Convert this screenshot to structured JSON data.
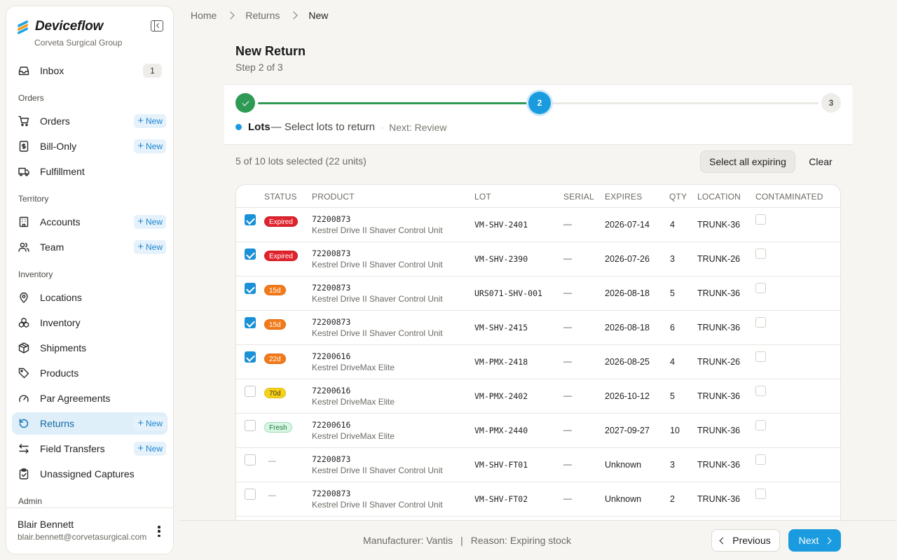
{
  "app": {
    "name": "Deviceflow",
    "org": "Corveta Surgical Group"
  },
  "sidebar": {
    "inbox": {
      "label": "Inbox",
      "count": "1"
    },
    "sections": {
      "orders": "Orders",
      "territory": "Territory",
      "inventory": "Inventory",
      "admin": "Admin"
    },
    "items": {
      "orders": "Orders",
      "bill_only": "Bill-Only",
      "fulfillment": "Fulfillment",
      "accounts": "Accounts",
      "team": "Team",
      "locations": "Locations",
      "inventory": "Inventory",
      "shipments": "Shipments",
      "products": "Products",
      "par_agreements": "Par Agreements",
      "returns": "Returns",
      "field_transfers": "Field Transfers",
      "unassigned_captures": "Unassigned Captures"
    },
    "new_label": "New",
    "user": {
      "name": "Blair Bennett",
      "email": "blair.bennett@corvetasurgical.com"
    }
  },
  "breadcrumb": [
    "Home",
    "Returns",
    "New"
  ],
  "page": {
    "title": "New Return",
    "step": "Step 2 of 3"
  },
  "stepper": {
    "current_number": "2",
    "last_number": "3",
    "step_name": "Lots",
    "step_desc": "— Select lots to return",
    "separator": "·",
    "next": "Next: Review"
  },
  "selection": {
    "summary": "5 of 10 lots selected (22 units)",
    "select_all_label": "Select all expiring",
    "clear_label": "Clear"
  },
  "table": {
    "columns": {
      "status": "STATUS",
      "product": "PRODUCT",
      "lot": "LOT",
      "serial": "SERIAL",
      "expires": "EXPIRES",
      "qty": "QTY",
      "location": "LOCATION",
      "contaminated": "CONTAMINATED"
    },
    "rows": [
      {
        "checked": true,
        "status": "Expired",
        "status_kind": "expired",
        "code": "72200873",
        "name": "Kestrel Drive II Shaver Control Unit",
        "lot": "VM-SHV-2401",
        "serial": "—",
        "expires": "2026-07-14",
        "qty": "4",
        "location": "TRUNK-36"
      },
      {
        "checked": true,
        "status": "Expired",
        "status_kind": "expired",
        "code": "72200873",
        "name": "Kestrel Drive II Shaver Control Unit",
        "lot": "VM-SHV-2390",
        "serial": "—",
        "expires": "2026-07-26",
        "qty": "3",
        "location": "TRUNK-26"
      },
      {
        "checked": true,
        "status": "15d",
        "status_kind": "orange",
        "code": "72200873",
        "name": "Kestrel Drive II Shaver Control Unit",
        "lot": "URS071-SHV-001",
        "serial": "—",
        "expires": "2026-08-18",
        "qty": "5",
        "location": "TRUNK-36"
      },
      {
        "checked": true,
        "status": "15d",
        "status_kind": "orange",
        "code": "72200873",
        "name": "Kestrel Drive II Shaver Control Unit",
        "lot": "VM-SHV-2415",
        "serial": "—",
        "expires": "2026-08-18",
        "qty": "6",
        "location": "TRUNK-36"
      },
      {
        "checked": true,
        "status": "22d",
        "status_kind": "orange",
        "code": "72200616",
        "name": "Kestrel DriveMax Elite",
        "lot": "VM-PMX-2418",
        "serial": "—",
        "expires": "2026-08-25",
        "qty": "4",
        "location": "TRUNK-26"
      },
      {
        "checked": false,
        "status": "70d",
        "status_kind": "yellow",
        "code": "72200616",
        "name": "Kestrel DriveMax Elite",
        "lot": "VM-PMX-2402",
        "serial": "—",
        "expires": "2026-10-12",
        "qty": "5",
        "location": "TRUNK-36"
      },
      {
        "checked": false,
        "status": "Fresh",
        "status_kind": "fresh",
        "code": "72200616",
        "name": "Kestrel DriveMax Elite",
        "lot": "VM-PMX-2440",
        "serial": "—",
        "expires": "2027-09-27",
        "qty": "10",
        "location": "TRUNK-36"
      },
      {
        "checked": false,
        "status": "—",
        "status_kind": "none",
        "code": "72200873",
        "name": "Kestrel Drive II Shaver Control Unit",
        "lot": "VM-SHV-FT01",
        "serial": "—",
        "expires": "Unknown",
        "qty": "3",
        "location": "TRUNK-36"
      },
      {
        "checked": false,
        "status": "—",
        "status_kind": "none",
        "code": "72200873",
        "name": "Kestrel Drive II Shaver Control Unit",
        "lot": "VM-SHV-FT02",
        "serial": "—",
        "expires": "Unknown",
        "qty": "2",
        "location": "TRUNK-36"
      }
    ]
  },
  "footer": {
    "manufacturer": "Manufacturer: Vantis",
    "divider": "|",
    "reason": "Reason: Expiring stock",
    "previous_label": "Previous",
    "next_label": "Next"
  },
  "colors": {
    "accent": "#1a9bdf",
    "success": "#2f9a55",
    "expired": "#e0222d",
    "warning": "#f27a1a",
    "caution": "#f5d21e"
  },
  "icons": {
    "inbox": "inbox-icon",
    "orders": "cart-icon",
    "bill_only": "receipt-icon",
    "fulfillment": "truck-icon",
    "accounts": "building-icon",
    "team": "users-icon",
    "locations": "map-pin-icon",
    "inventory": "boxes-icon",
    "shipments": "package-icon",
    "products": "tag-icon",
    "par_agreements": "gauge-icon",
    "returns": "return-icon",
    "field_transfers": "transfer-icon",
    "unassigned_captures": "clipboard-icon"
  }
}
